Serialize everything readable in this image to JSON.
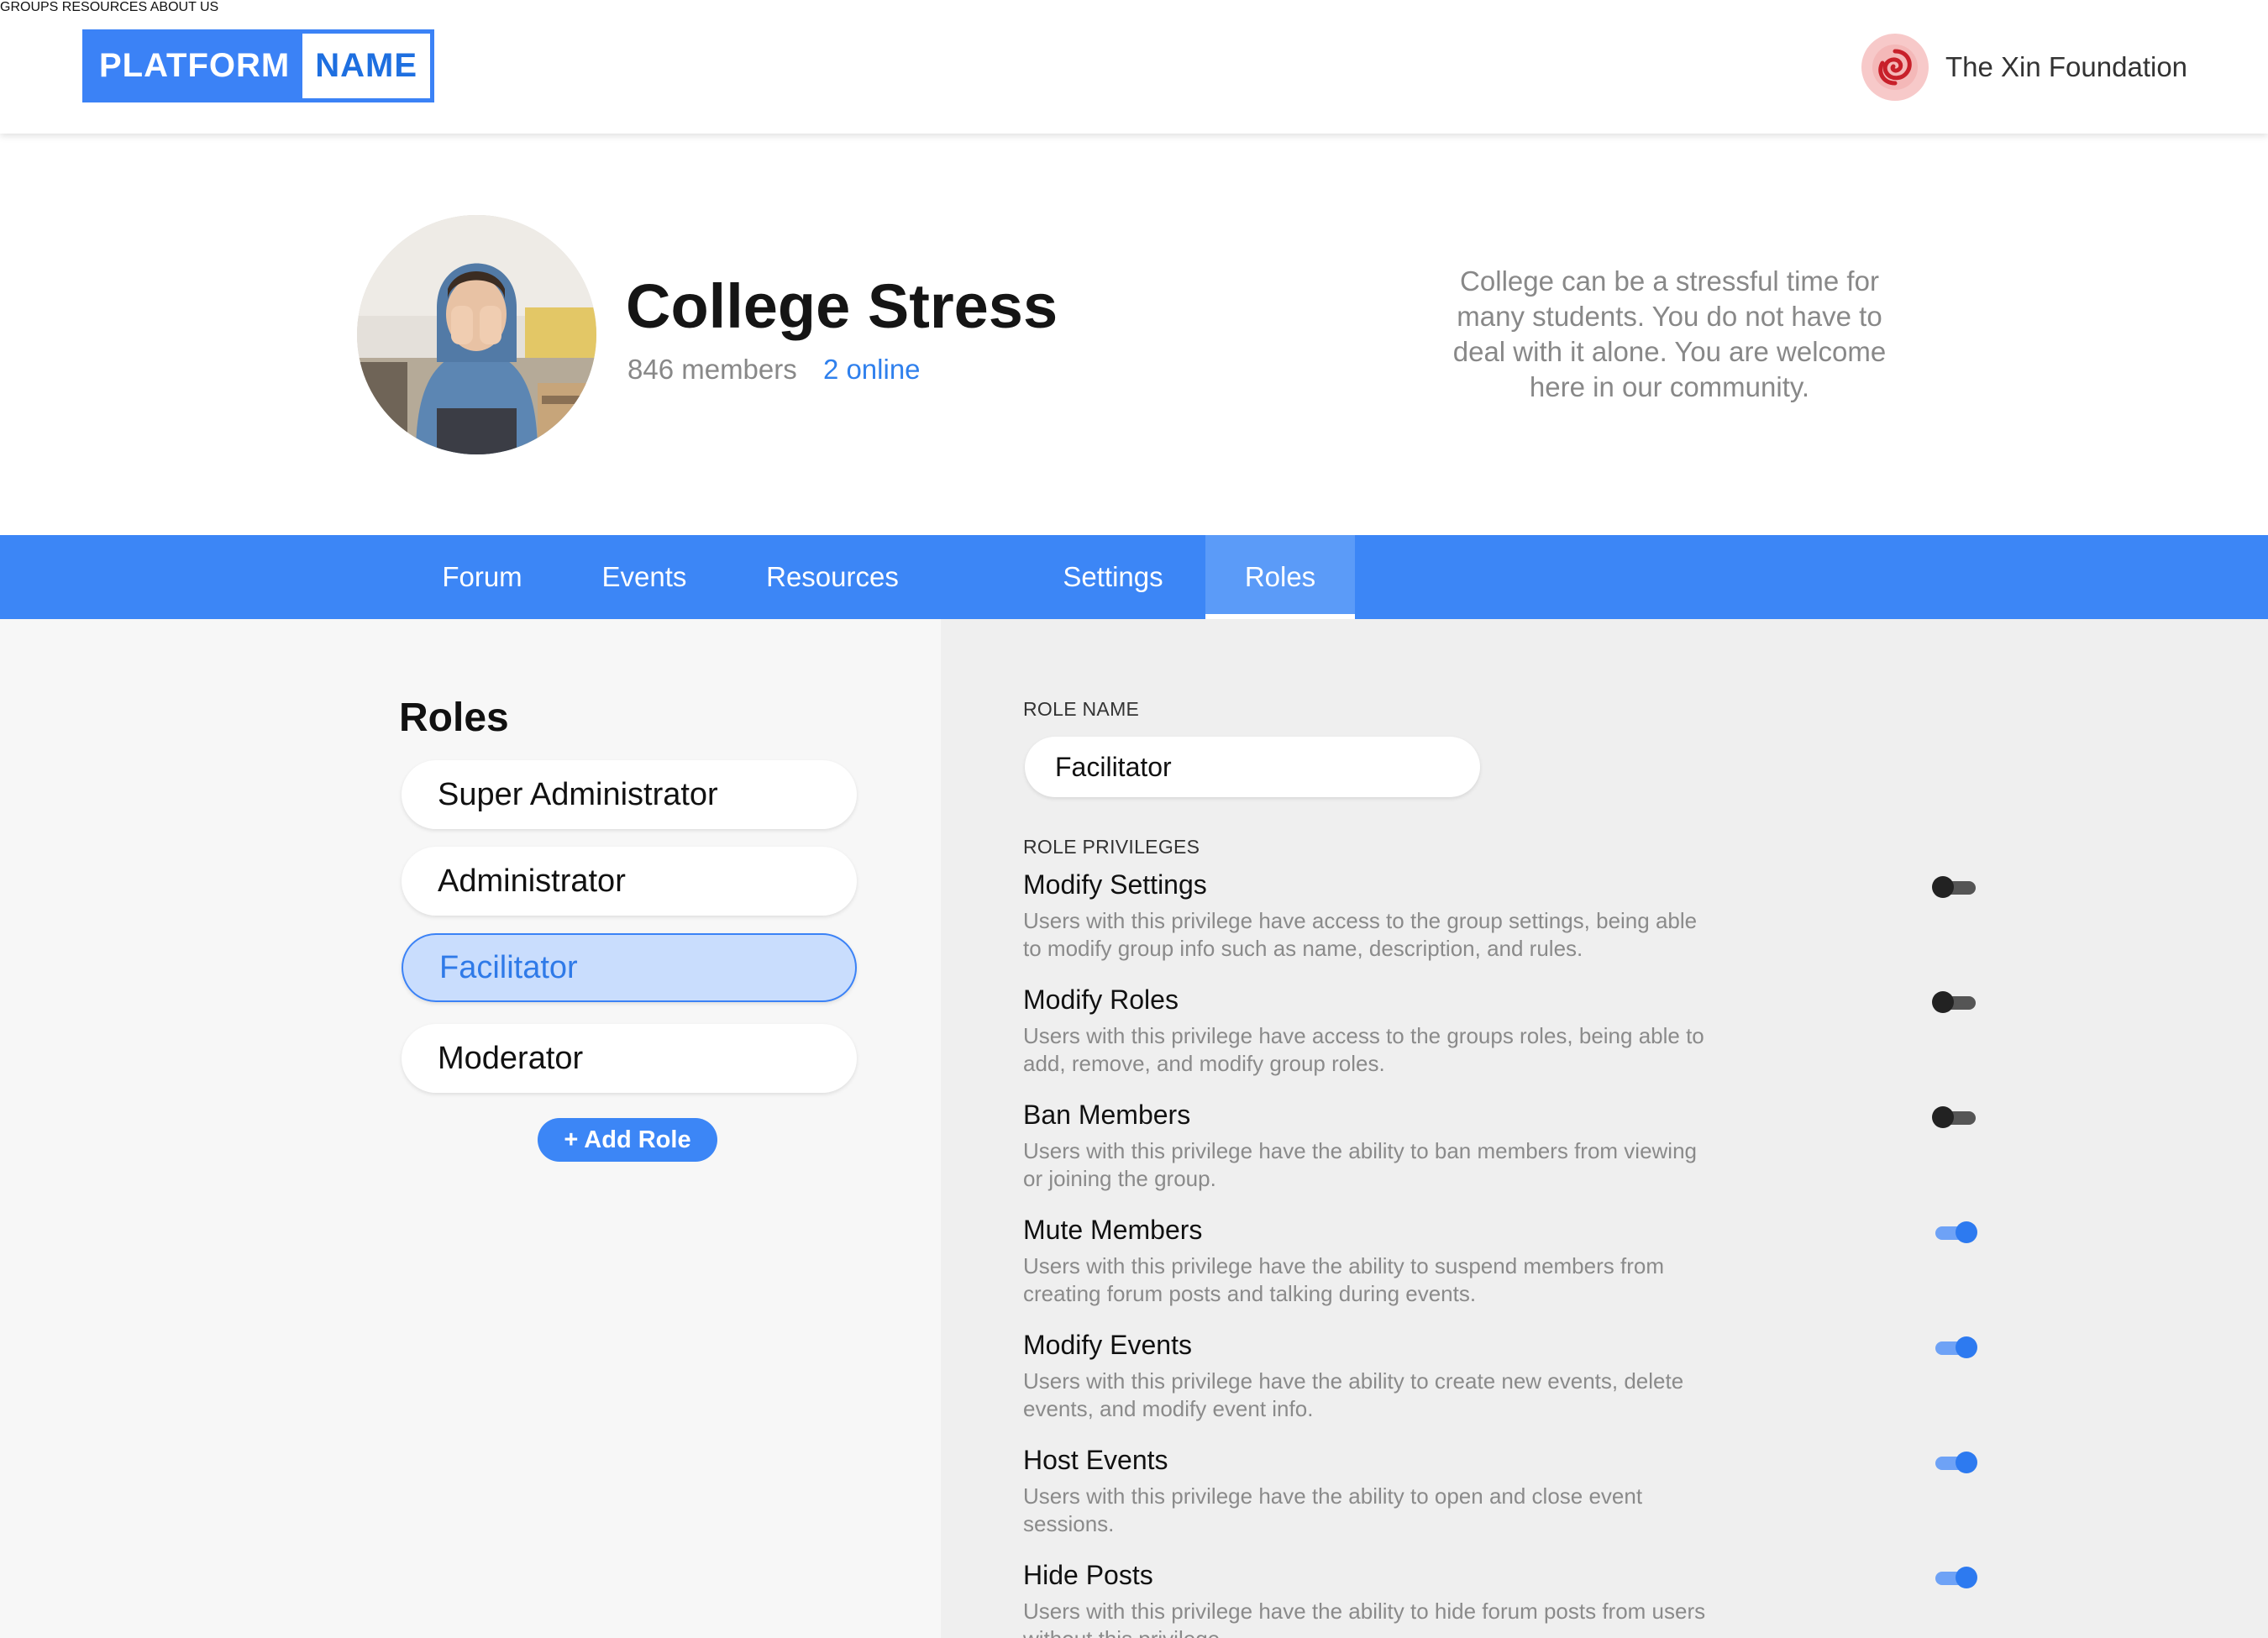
{
  "header": {
    "logo_part1": "PLATFORM",
    "logo_part2": "NAME",
    "nav": [
      "GROUPS",
      "RESOURCES",
      "ABOUT US"
    ],
    "org_name": "The Xin Foundation",
    "org_icon": "spiral-logo-icon"
  },
  "group": {
    "title": "College Stress",
    "members": "846 members",
    "online": "2 online",
    "description": "College can be a stressful time for many students. You do not have to deal with it alone. You are welcome here in our community."
  },
  "tabs": [
    {
      "label": "Forum",
      "active": false
    },
    {
      "label": "Events",
      "active": false
    },
    {
      "label": "Resources",
      "active": false
    },
    {
      "label": "Settings",
      "active": false
    },
    {
      "label": "Roles",
      "active": true
    }
  ],
  "roles": {
    "heading": "Roles",
    "items": [
      {
        "label": "Super Administrator",
        "selected": false
      },
      {
        "label": "Administrator",
        "selected": false
      },
      {
        "label": "Facilitator",
        "selected": true
      },
      {
        "label": "Moderator",
        "selected": false
      }
    ],
    "add_label": "+ Add Role"
  },
  "role_form": {
    "name_label": "ROLE NAME",
    "name_value": "Facilitator",
    "privileges_label": "ROLE PRIVILEGES",
    "privileges": [
      {
        "title": "Modify Settings",
        "description": "Users with this privilege have access to the group settings, being able to modify group info such as name, description, and rules.",
        "enabled": false
      },
      {
        "title": "Modify Roles",
        "description": "Users with this privilege have access to the groups roles, being able to add, remove, and modify group roles.",
        "enabled": false
      },
      {
        "title": "Ban Members",
        "description": "Users with this privilege have the ability to ban members from viewing or joining the group.",
        "enabled": false
      },
      {
        "title": "Mute Members",
        "description": "Users with this privilege have the ability to suspend members from creating forum posts and talking during events.",
        "enabled": true
      },
      {
        "title": "Modify Events",
        "description": "Users with this privilege have the ability to create new events, delete events, and modify event info.",
        "enabled": true
      },
      {
        "title": "Host Events",
        "description": "Users with this privilege have the ability to open and close event sessions.",
        "enabled": true
      },
      {
        "title": "Hide Posts",
        "description": "Users with this privilege have the ability to hide forum posts from users without this privilege.",
        "enabled": true
      }
    ]
  },
  "colors": {
    "accent": "#3c86f6",
    "link": "#2f80ed",
    "selected_bg": "#c9ddfd"
  }
}
